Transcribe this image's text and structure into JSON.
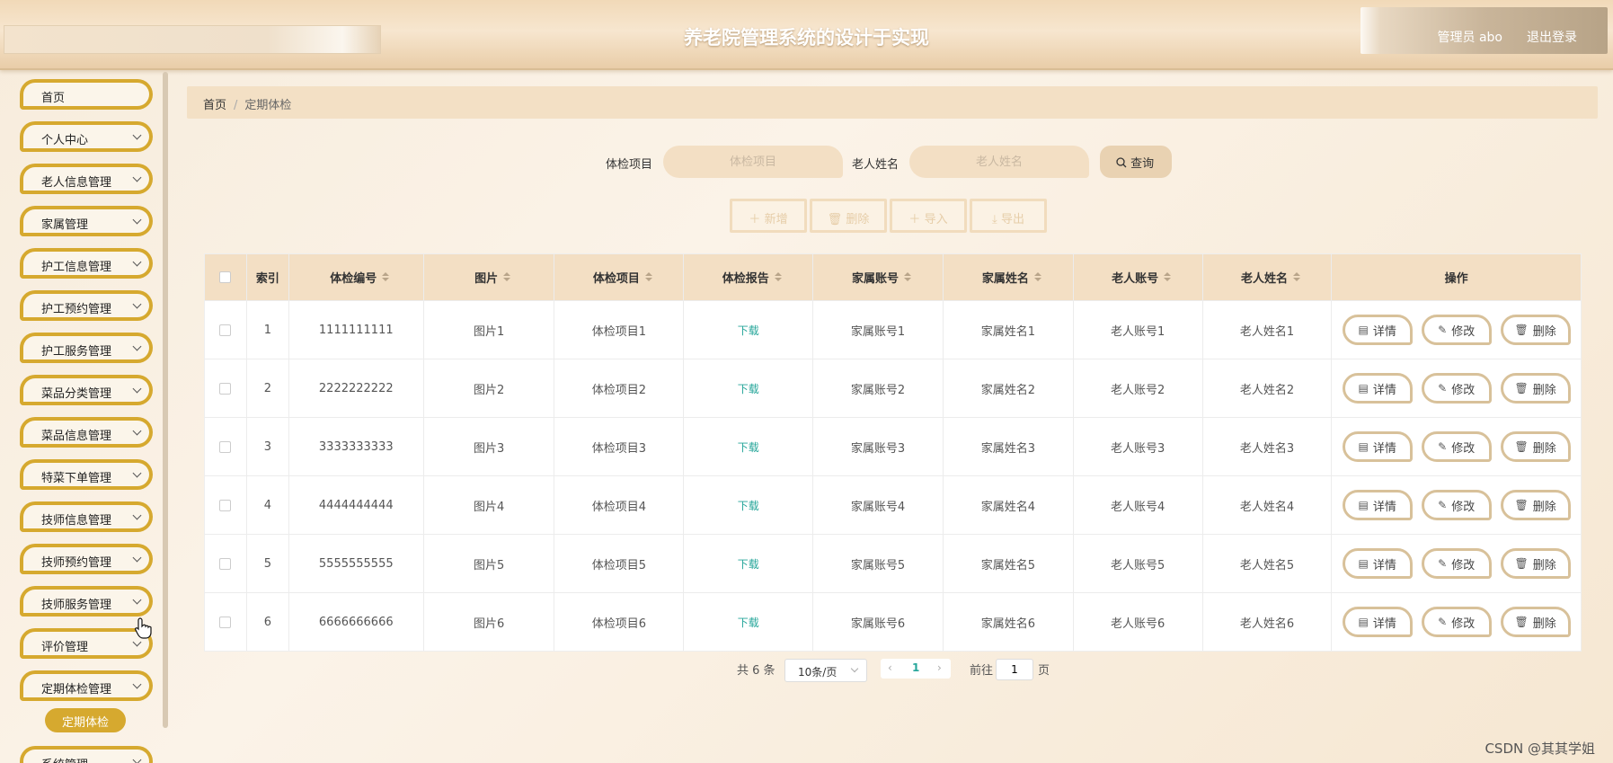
{
  "header": {
    "title": "养老院管理系统的设计于实现",
    "user": "管理员 abo",
    "logout": "退出登录"
  },
  "sidebar": {
    "items": [
      {
        "label": "首页",
        "has_chevron": false
      },
      {
        "label": "个人中心",
        "has_chevron": true
      },
      {
        "label": "老人信息管理",
        "has_chevron": true
      },
      {
        "label": "家属管理",
        "has_chevron": true
      },
      {
        "label": "护工信息管理",
        "has_chevron": true
      },
      {
        "label": "护工预约管理",
        "has_chevron": true
      },
      {
        "label": "护工服务管理",
        "has_chevron": true
      },
      {
        "label": "菜品分类管理",
        "has_chevron": true
      },
      {
        "label": "菜品信息管理",
        "has_chevron": true
      },
      {
        "label": "特菜下单管理",
        "has_chevron": true
      },
      {
        "label": "技师信息管理",
        "has_chevron": true
      },
      {
        "label": "技师预约管理",
        "has_chevron": true
      },
      {
        "label": "技师服务管理",
        "has_chevron": true
      },
      {
        "label": "评价管理",
        "has_chevron": true
      },
      {
        "label": "定期体检管理",
        "has_chevron": true
      },
      {
        "label": "系统管理",
        "has_chevron": true
      }
    ],
    "active_submenu": "定期体检"
  },
  "breadcrumb": {
    "home": "首页",
    "separator": "/",
    "current": "定期体检"
  },
  "search": {
    "field1_label": "体检项目",
    "field1_placeholder": "体检项目",
    "field2_label": "老人姓名",
    "field2_placeholder": "老人姓名",
    "query_label": "查询"
  },
  "actions": {
    "add": "新增",
    "delete": "删除",
    "import": "导入",
    "export": "导出"
  },
  "table": {
    "headers": [
      "索引",
      "体检编号",
      "图片",
      "体检项目",
      "体检报告",
      "家属账号",
      "家属姓名",
      "老人账号",
      "老人姓名",
      "操作"
    ],
    "rows": [
      [
        "1",
        "1111111111",
        "图片1",
        "体检项目1",
        "下载",
        "家属账号1",
        "家属姓名1",
        "老人账号1",
        "老人姓名1"
      ],
      [
        "2",
        "2222222222",
        "图片2",
        "体检项目2",
        "下载",
        "家属账号2",
        "家属姓名2",
        "老人账号2",
        "老人姓名2"
      ],
      [
        "3",
        "3333333333",
        "图片3",
        "体检项目3",
        "下载",
        "家属账号3",
        "家属姓名3",
        "老人账号3",
        "老人姓名3"
      ],
      [
        "4",
        "4444444444",
        "图片4",
        "体检项目4",
        "下载",
        "家属账号4",
        "家属姓名4",
        "老人账号4",
        "老人姓名4"
      ],
      [
        "5",
        "5555555555",
        "图片5",
        "体检项目5",
        "下载",
        "家属账号5",
        "家属姓名5",
        "老人账号5",
        "老人姓名5"
      ],
      [
        "6",
        "6666666666",
        "图片6",
        "体检项目6",
        "下载",
        "家属账号6",
        "家属姓名6",
        "老人账号6",
        "老人姓名6"
      ]
    ],
    "row_actions": {
      "detail": "详情",
      "edit": "修改",
      "delete": "删除"
    }
  },
  "pagination": {
    "total": "共 6 条",
    "page_size": "10条/页",
    "current_page": "1",
    "goto_label": "前往",
    "goto_value": "1",
    "page_suffix": "页"
  },
  "watermark": "CSDN @其其学姐",
  "colors": {
    "accent": "#d6a92f",
    "header_bg": "#f3dfc4",
    "link": "#26a69a"
  }
}
